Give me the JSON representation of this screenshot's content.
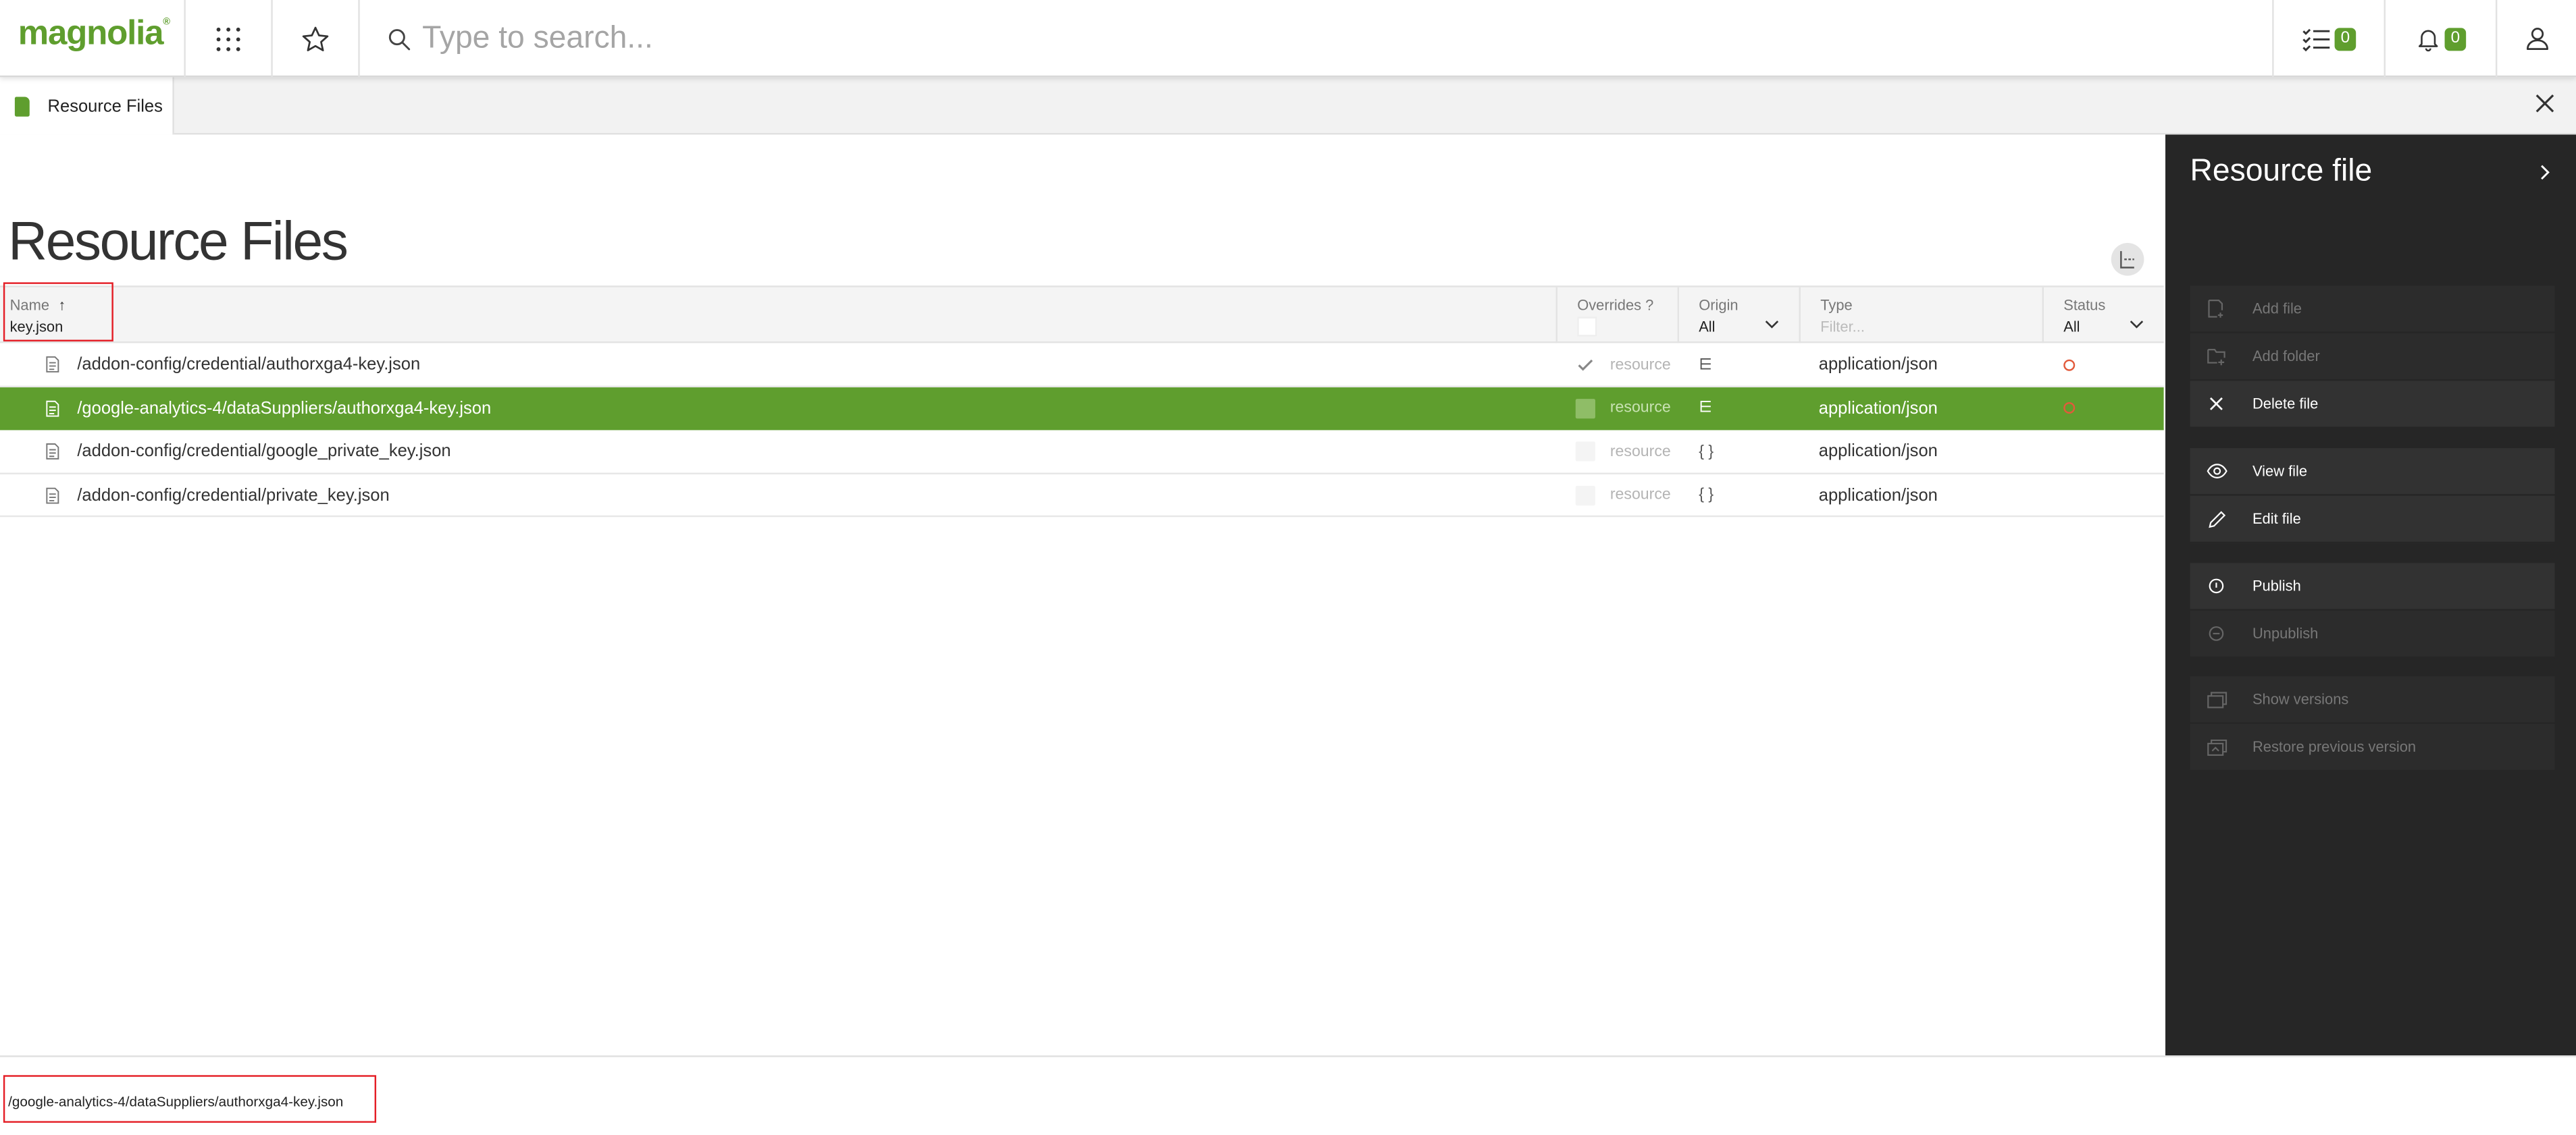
{
  "header": {
    "logo": "magnolia",
    "logo_mark": "®",
    "search_placeholder": "Type to search...",
    "tasks_count": "0",
    "notifications_count": "0",
    "icons": [
      "app-launcher-icon",
      "star-icon",
      "search-icon",
      "tasks-icon",
      "bell-icon",
      "user-icon"
    ]
  },
  "tab": {
    "label": "Resource Files",
    "icon": "resource-file-icon"
  },
  "page": {
    "title": "Resource Files"
  },
  "grid": {
    "columns": {
      "name": {
        "label": "Name",
        "sort_mark": "↑",
        "filter_value": "key.json"
      },
      "overrides": {
        "label": "Overrides ?"
      },
      "origin": {
        "label": "Origin",
        "filter_value": "All"
      },
      "type": {
        "label": "Type",
        "filter_placeholder": "Filter..."
      },
      "status": {
        "label": "Status",
        "filter_value": "All"
      }
    },
    "rows": [
      {
        "name": "/addon-config/credential/authorxga4-key.json",
        "overrides": "resource",
        "overrides_checked": true,
        "origin": "⋿",
        "type": "application/json",
        "status_icon": "status-circle-icon",
        "selected": false
      },
      {
        "name": "/google-analytics-4/dataSuppliers/authorxga4-key.json",
        "overrides": "resource",
        "overrides_checked": false,
        "origin": "⋿",
        "type": "application/json",
        "status_icon": "status-circle-icon",
        "selected": true
      },
      {
        "name": "/addon-config/credential/google_private_key.json",
        "overrides": "resource",
        "overrides_checked": false,
        "origin": "{ }",
        "type": "application/json",
        "status_icon": "",
        "selected": false
      },
      {
        "name": "/addon-config/credential/private_key.json",
        "overrides": "resource",
        "overrides_checked": false,
        "origin": "{ }",
        "type": "application/json",
        "status_icon": "",
        "selected": false
      }
    ]
  },
  "actionbar": {
    "title": "Resource file",
    "groups": [
      [
        {
          "label": "Add file",
          "icon": "add-file-icon",
          "enabled": false
        },
        {
          "label": "Add folder",
          "icon": "add-folder-icon",
          "enabled": false
        },
        {
          "label": "Delete file",
          "icon": "close-icon",
          "enabled": true
        }
      ],
      [
        {
          "label": "View file",
          "icon": "eye-icon",
          "enabled": true
        },
        {
          "label": "Edit file",
          "icon": "pencil-icon",
          "enabled": true
        }
      ],
      [
        {
          "label": "Publish",
          "icon": "publish-icon",
          "enabled": true
        },
        {
          "label": "Unpublish",
          "icon": "unpublish-icon",
          "enabled": false
        }
      ],
      [
        {
          "label": "Show versions",
          "icon": "versions-icon",
          "enabled": false
        },
        {
          "label": "Restore previous version",
          "icon": "restore-version-icon",
          "enabled": false
        }
      ]
    ]
  },
  "footer": {
    "selected_path": "/google-analytics-4/dataSuppliers/authorxga4-key.json"
  },
  "colors": {
    "accent": "#5f9e2e",
    "actionbar_bg": "#262626",
    "highlight": "#e41e26",
    "status": "#e25a3b"
  }
}
